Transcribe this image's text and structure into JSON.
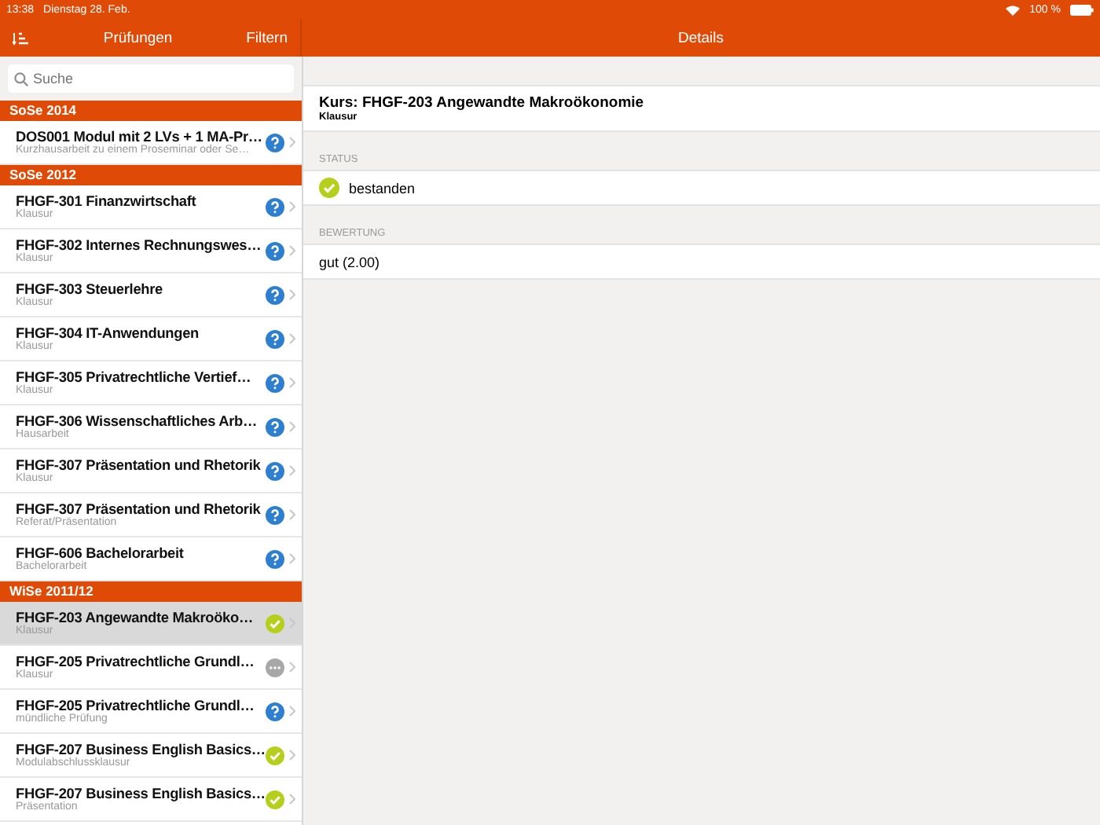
{
  "status_bar": {
    "time": "13:38",
    "date": "Dienstag 28. Feb.",
    "battery": "100 %"
  },
  "master": {
    "title": "Prüfungen",
    "filter_button": "Filtern",
    "search": {
      "placeholder": "Suche"
    },
    "sections": [
      {
        "header": "SoSe 2014",
        "rows": [
          {
            "title": "DOS001 Modul mit 2 LVs + 1 MA-Pr…",
            "subtitle": "Kurzhausarbeit zu einem Proseminar oder Se…",
            "kind": "open",
            "selected": false
          }
        ]
      },
      {
        "header": "SoSe 2012",
        "rows": [
          {
            "title": "FHGF-301 Finanzwirtschaft",
            "subtitle": "Klausur",
            "kind": "open",
            "selected": false
          },
          {
            "title": "FHGF-302 Internes Rechnungswes…",
            "subtitle": "Klausur",
            "kind": "open",
            "selected": false
          },
          {
            "title": "FHGF-303 Steuerlehre",
            "subtitle": "Klausur",
            "kind": "open",
            "selected": false
          },
          {
            "title": "FHGF-304 IT-Anwendungen",
            "subtitle": "Klausur",
            "kind": "open",
            "selected": false
          },
          {
            "title": "FHGF-305 Privatrechtliche Vertief…",
            "subtitle": "Klausur",
            "kind": "open",
            "selected": false
          },
          {
            "title": "FHGF-306 Wissenschaftliches Arb…",
            "subtitle": "Hausarbeit",
            "kind": "open",
            "selected": false
          },
          {
            "title": "FHGF-307 Präsentation und Rhetorik",
            "subtitle": "Klausur",
            "kind": "open",
            "selected": false
          },
          {
            "title": "FHGF-307 Präsentation und Rhetorik",
            "subtitle": "Referat/Präsentation",
            "kind": "open",
            "selected": false
          },
          {
            "title": "FHGF-606 Bachelorarbeit",
            "subtitle": "Bachelorarbeit",
            "kind": "open",
            "selected": false
          }
        ]
      },
      {
        "header": "WiSe 2011/12",
        "rows": [
          {
            "title": "FHGF-203 Angewandte Makroöko…",
            "subtitle": "Klausur",
            "kind": "passed",
            "selected": true
          },
          {
            "title": "FHGF-205 Privatrechtliche Grundl…",
            "subtitle": "Klausur",
            "kind": "pending",
            "selected": false
          },
          {
            "title": "FHGF-205 Privatrechtliche Grundl…",
            "subtitle": "mündliche Prüfung",
            "kind": "open",
            "selected": false
          },
          {
            "title": "FHGF-207 Business English Basics…",
            "subtitle": "Modulabschlussklausur",
            "kind": "passed",
            "selected": false
          },
          {
            "title": "FHGF-207 Business English Basics…",
            "subtitle": "Präsentation",
            "kind": "passed",
            "selected": false
          }
        ]
      }
    ]
  },
  "detail": {
    "title": "Details",
    "course": {
      "title": "Kurs: FHGF-203 Angewandte Makroökonomie",
      "subtitle": "Klausur"
    },
    "status_label": "STATUS",
    "status": {
      "kind": "passed",
      "text": "bestanden"
    },
    "grade_label": "BEWERTUNG",
    "grade": "gut (2.00)"
  }
}
